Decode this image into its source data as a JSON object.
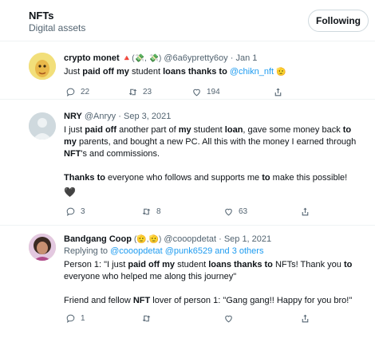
{
  "topic": {
    "title": "NFTs",
    "subtitle": "Digital assets",
    "follow_label": "Following"
  },
  "tweets": [
    {
      "name": "crypto monet",
      "name_emoji": "🔺(💸, 💸)",
      "handle": "@6a6ypretty6oy",
      "sep": "·",
      "date": "Jan 1",
      "text_plain_1": "Just ",
      "text_bold_1": "paid off my",
      "text_plain_2": " student ",
      "text_bold_2": "loans thanks to",
      "mention": "@chikn_nft",
      "text_emoji": "🫡",
      "replies": "22",
      "retweets": "23",
      "likes": "194"
    },
    {
      "name": "NRY",
      "handle": "@Anryy",
      "sep": "·",
      "date": "Sep 3, 2021",
      "line1_a": "I just ",
      "line1_b": "paid off",
      "line1_c": " another part of ",
      "line1_d": "my",
      "line1_e": " student ",
      "line1_f": "loan",
      "line1_g": ", gave some money back ",
      "line1_h": "to",
      "line2_a": "my",
      "line2_b": " parents, and bought a new PC. All this with the money I earned through",
      "line3_a": "NFT",
      "line3_b": "'s and commissions.",
      "line4_a": "Thanks to",
      "line4_b": " everyone who follows and supports me ",
      "line4_c": "to",
      "line4_d": " make this possible!",
      "heart": "🖤",
      "replies": "3",
      "retweets": "8",
      "likes": "63"
    },
    {
      "name": "Bandgang Coop",
      "name_emoji": "(🫡,🫡)",
      "handle": "@cooopdetat",
      "sep": "·",
      "date": "Sep 1, 2021",
      "reply_prefix": "Replying to ",
      "reply_to": "@cooopdetat @punk6529 and 3 others",
      "l1_a": "Person 1: \"I just ",
      "l1_b": "paid off my",
      "l1_c": " student ",
      "l1_d": "loans thanks to",
      "l1_e": " NFTs! Thank you ",
      "l1_f": "to",
      "l2": "everyone who helped me along this journey\"",
      "l3_a": "Friend and fellow ",
      "l3_b": "NFT",
      "l3_c": " lover of person 1: \"Gang gang!! Happy for you bro!\"",
      "replies": "1",
      "retweets": "",
      "likes": ""
    }
  ],
  "colors": {
    "link": "#1d9bf0",
    "muted": "#536471",
    "text": "#0f1419",
    "divider": "#eff3f4"
  },
  "icons": [
    "reply-icon",
    "retweet-icon",
    "like-icon",
    "share-icon"
  ]
}
